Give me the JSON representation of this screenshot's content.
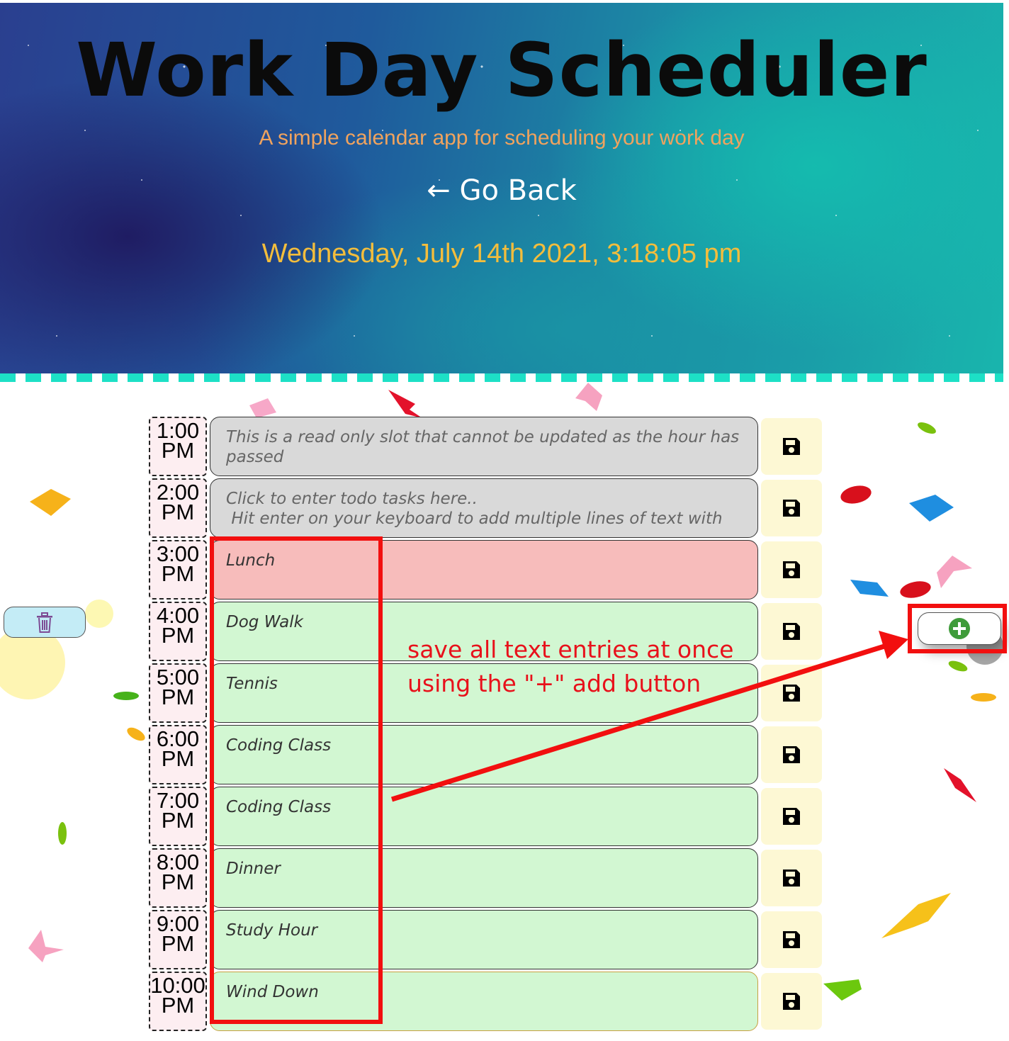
{
  "header": {
    "title": "Work Day Scheduler",
    "subtitle": "A simple calendar app for scheduling your work day",
    "go_back": "← Go Back",
    "current_datetime": "Wednesday, July 14th 2021, 3:18:05 pm"
  },
  "side_actions": {
    "delete_all_icon": "trash-icon",
    "add_all_icon": "plus-circle-icon"
  },
  "colors": {
    "past": "#d9d9d9",
    "present": "#f7bcbb",
    "future": "#d2f7d2",
    "save_button_bg": "#fdf8d4",
    "annotation": "#f20f0f",
    "date_text": "#f3bd3c"
  },
  "schedule": {
    "rows": [
      {
        "hour_num": "1:00",
        "hour_ampm": "PM",
        "status": "past",
        "text": "This is a read only slot that cannot be updated as the hour has passed",
        "save_icon": "floppy-disk-icon"
      },
      {
        "hour_num": "2:00",
        "hour_ampm": "PM",
        "status": "past",
        "text": "Click to enter todo tasks here..\n Hit enter on your keyboard to add multiple lines of text with",
        "save_icon": "floppy-disk-icon"
      },
      {
        "hour_num": "3:00",
        "hour_ampm": "PM",
        "status": "present",
        "text": "Lunch",
        "save_icon": "floppy-disk-icon"
      },
      {
        "hour_num": "4:00",
        "hour_ampm": "PM",
        "status": "future",
        "text": "Dog Walk",
        "save_icon": "floppy-disk-icon"
      },
      {
        "hour_num": "5:00",
        "hour_ampm": "PM",
        "status": "future",
        "text": "Tennis",
        "save_icon": "floppy-disk-icon"
      },
      {
        "hour_num": "6:00",
        "hour_ampm": "PM",
        "status": "future",
        "text": "Coding Class",
        "save_icon": "floppy-disk-icon"
      },
      {
        "hour_num": "7:00",
        "hour_ampm": "PM",
        "status": "future",
        "text": "Coding Class",
        "save_icon": "floppy-disk-icon"
      },
      {
        "hour_num": "8:00",
        "hour_ampm": "PM",
        "status": "future",
        "text": "Dinner",
        "save_icon": "floppy-disk-icon"
      },
      {
        "hour_num": "9:00",
        "hour_ampm": "PM",
        "status": "future",
        "text": "Study Hour",
        "save_icon": "floppy-disk-icon"
      },
      {
        "hour_num": "10:00",
        "hour_ampm": "PM",
        "status": "future",
        "text": "Wind Down",
        "save_icon": "floppy-disk-icon"
      }
    ]
  },
  "annotation": {
    "line1": "save all text entries at once",
    "line2": "using the \"+\" add button"
  }
}
